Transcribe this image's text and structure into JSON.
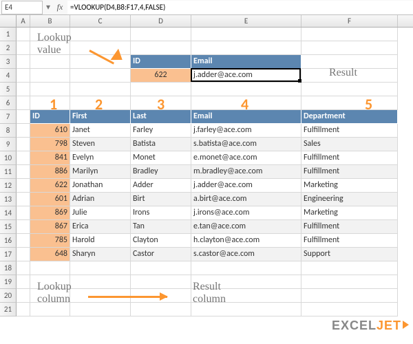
{
  "formula_bar": {
    "active_cell": "E4",
    "formula": "=VLOOKUP(D4,B8:F17,4,FALSE)"
  },
  "columns": {
    "A": "A",
    "B": "B",
    "C": "C",
    "D": "D",
    "E": "E",
    "F": "F"
  },
  "rows": [
    "1",
    "2",
    "3",
    "4",
    "5",
    "6",
    "7",
    "8",
    "9",
    "10",
    "11",
    "12",
    "13",
    "14",
    "15",
    "16",
    "17",
    "18",
    "19",
    "20",
    "21"
  ],
  "lookup_header": {
    "id": "ID",
    "email": "Email"
  },
  "lookup_row": {
    "id": "622",
    "email": "j.adder@ace.com"
  },
  "table_header": {
    "id": "ID",
    "first": "First",
    "last": "Last",
    "email": "Email",
    "dept": "Department"
  },
  "col_numbers": [
    "1",
    "2",
    "3",
    "4",
    "5"
  ],
  "table_rows": [
    {
      "id": "610",
      "first": "Janet",
      "last": "Farley",
      "email": "j.farley@ace.com",
      "dept": "Fulfillment"
    },
    {
      "id": "798",
      "first": "Steven",
      "last": "Batista",
      "email": "s.batista@ace.com",
      "dept": "Sales"
    },
    {
      "id": "841",
      "first": "Evelyn",
      "last": "Monet",
      "email": "e.monet@ace.com",
      "dept": "Fulfillment"
    },
    {
      "id": "886",
      "first": "Marilyn",
      "last": "Bradley",
      "email": "m.bradley@ace.com",
      "dept": "Fulfillment"
    },
    {
      "id": "622",
      "first": "Jonathan",
      "last": "Adder",
      "email": "j.adder@ace.com",
      "dept": "Marketing"
    },
    {
      "id": "601",
      "first": "Adrian",
      "last": "Birt",
      "email": "a.birt@ace.com",
      "dept": "Engineering"
    },
    {
      "id": "869",
      "first": "Julie",
      "last": "Irons",
      "email": "j.irons@ace.com",
      "dept": "Marketing"
    },
    {
      "id": "867",
      "first": "Erica",
      "last": "Tan",
      "email": "e.tan@ace.com",
      "dept": "Fulfillment"
    },
    {
      "id": "785",
      "first": "Harold",
      "last": "Clayton",
      "email": "h.clayton@ace.com",
      "dept": "Fulfillment"
    },
    {
      "id": "648",
      "first": "Sharyn",
      "last": "Castor",
      "email": "s.castor@ace.com",
      "dept": "Support"
    }
  ],
  "annotations": {
    "lookup_value": "Lookup\nvalue",
    "result": "Result",
    "lookup_column": "Lookup\ncolumn",
    "result_column": "Result\ncolumn"
  },
  "logo": {
    "part1": "EXCEL",
    "part2": "JET"
  }
}
